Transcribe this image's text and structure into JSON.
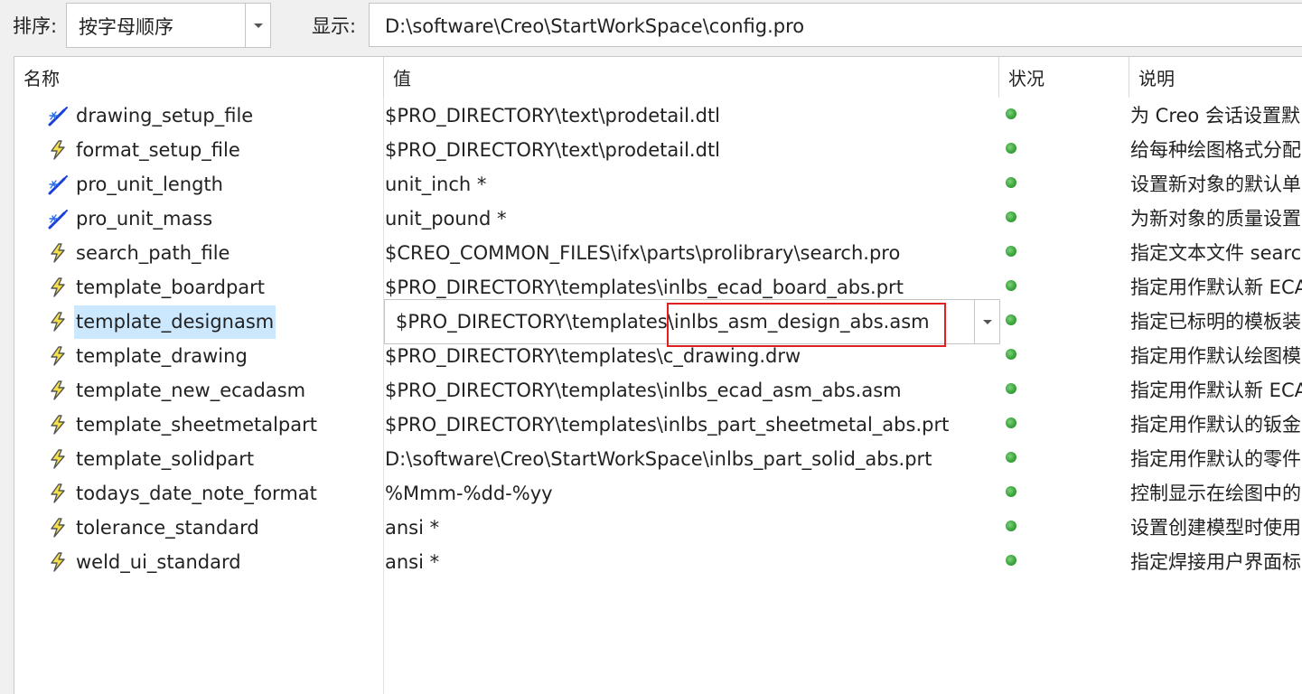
{
  "toolbar": {
    "sort_label": "排序:",
    "sort_value": "按字母顺序",
    "show_label": "显示:",
    "show_path": "D:\\software\\Creo\\StartWorkSpace\\config.pro"
  },
  "table": {
    "columns": {
      "name": "名称",
      "value": "值",
      "status": "状况",
      "desc": "说明"
    },
    "rows": [
      {
        "name": "drawing_setup_file",
        "value": "$PRO_DIRECTORY\\text\\prodetail.dtl",
        "desc": "为 Creo 会话设置默",
        "icon": "wand-icon"
      },
      {
        "name": "format_setup_file",
        "value": "$PRO_DIRECTORY\\text\\prodetail.dtl",
        "desc": "给每种绘图格式分配",
        "icon": "lightning-icon"
      },
      {
        "name": "pro_unit_length",
        "value": "unit_inch *",
        "desc": "设置新对象的默认单",
        "icon": "wand-icon"
      },
      {
        "name": "pro_unit_mass",
        "value": "unit_pound *",
        "desc": "为新对象的质量设置",
        "icon": "wand-icon"
      },
      {
        "name": "search_path_file",
        "value": "$CREO_COMMON_FILES\\ifx\\parts\\prolibrary\\search.pro",
        "desc": "指定文本文件 searc",
        "icon": "lightning-icon"
      },
      {
        "name": "template_boardpart",
        "value": "$PRO_DIRECTORY\\templates\\inlbs_ecad_board_abs.prt",
        "desc": "指定用作默认新 ECA",
        "icon": "lightning-icon"
      },
      {
        "name": "template_designasm",
        "value": "$PRO_DIRECTORY\\templates\\inlbs_asm_design_abs.asm",
        "desc": "指定已标明的模板装",
        "icon": "lightning-icon",
        "selected": true
      },
      {
        "name": "template_drawing",
        "value": "$PRO_DIRECTORY\\templates\\c_drawing.drw",
        "desc": "指定用作默认绘图模",
        "icon": "lightning-icon"
      },
      {
        "name": "template_new_ecadasm",
        "value": "$PRO_DIRECTORY\\templates\\inlbs_ecad_asm_abs.asm",
        "desc": "指定用作默认新 ECA",
        "icon": "lightning-icon"
      },
      {
        "name": "template_sheetmetalpart",
        "value": "$PRO_DIRECTORY\\templates\\inlbs_part_sheetmetal_abs.prt",
        "desc": "指定用作默认的钣金",
        "icon": "lightning-icon"
      },
      {
        "name": "template_solidpart",
        "value": "D:\\software\\Creo\\StartWorkSpace\\inlbs_part_solid_abs.prt",
        "desc": "指定用作默认的零件",
        "icon": "lightning-icon"
      },
      {
        "name": "todays_date_note_format",
        "value": "%Mmm-%dd-%yy",
        "desc": "控制显示在绘图中的",
        "icon": "lightning-icon"
      },
      {
        "name": "tolerance_standard",
        "value": "ansi *",
        "desc": "设置创建模型时使用",
        "icon": "lightning-icon"
      },
      {
        "name": "weld_ui_standard",
        "value": "ansi *",
        "desc": "指定焊接用户界面标",
        "icon": "lightning-icon"
      }
    ]
  },
  "colors": {
    "status_ok": "#3aa53a",
    "selection": "#cce8ff",
    "highlight_box": "#e02020",
    "wand": "#1a3fd6",
    "lightning_fill": "#f5e04a"
  }
}
